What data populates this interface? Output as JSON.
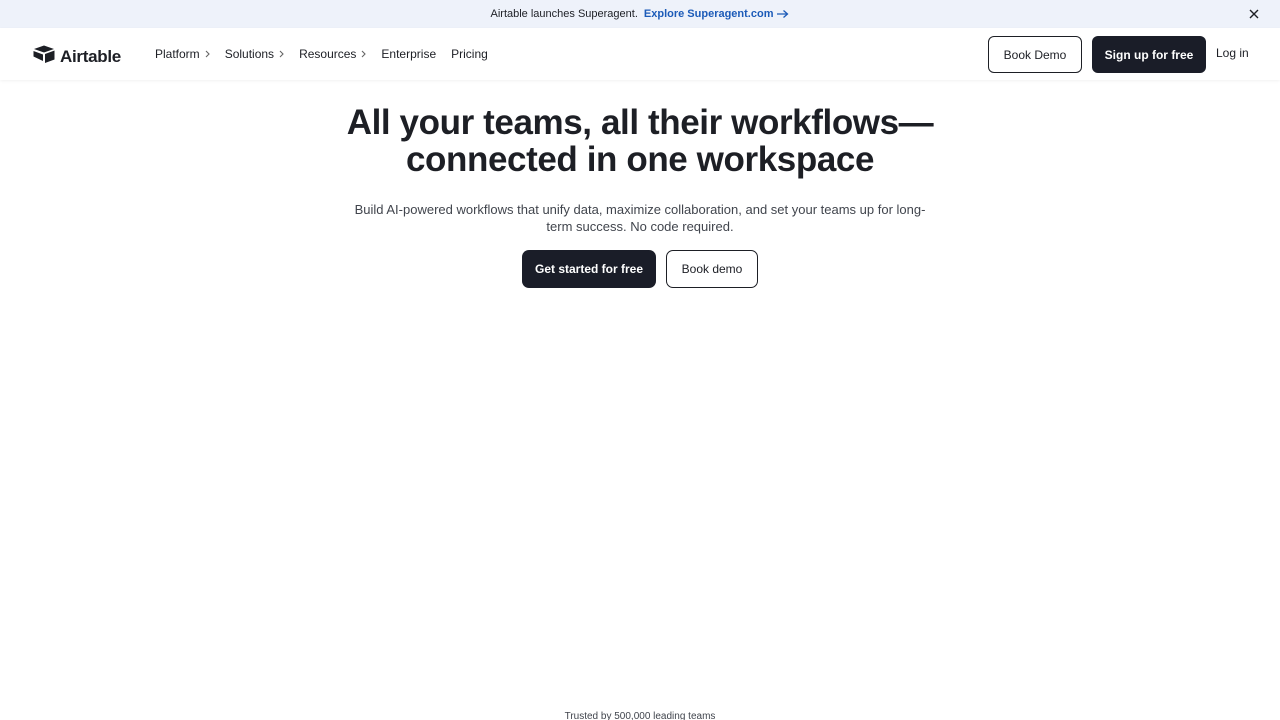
{
  "banner": {
    "text": "Airtable launches Superagent.",
    "link": "Explore Superagent.com"
  },
  "nav": {
    "brand": "Airtable",
    "items": [
      {
        "label": "Platform"
      },
      {
        "label": "Solutions"
      },
      {
        "label": "Resources"
      },
      {
        "label": "Enterprise"
      },
      {
        "label": "Pricing"
      }
    ],
    "book_demo": "Book Demo",
    "signup": "Sign up for free",
    "login": "Log in"
  },
  "hero": {
    "title_line1": "All your teams, all their workflows—",
    "title_line2": "connected in one workspace",
    "subtitle": "Build AI-powered workflows that unify data, maximize collaboration, and set your teams up for long-term success. No code required.",
    "cta_primary": "Get started for free",
    "cta_secondary": "Book demo"
  },
  "trusted": "Trusted by 500,000 leading teams",
  "colors": {
    "banner_bg": "#eef2fa",
    "link": "#1c5bb8",
    "dark_button": "#1a1d28",
    "text": "#1d1f25"
  }
}
